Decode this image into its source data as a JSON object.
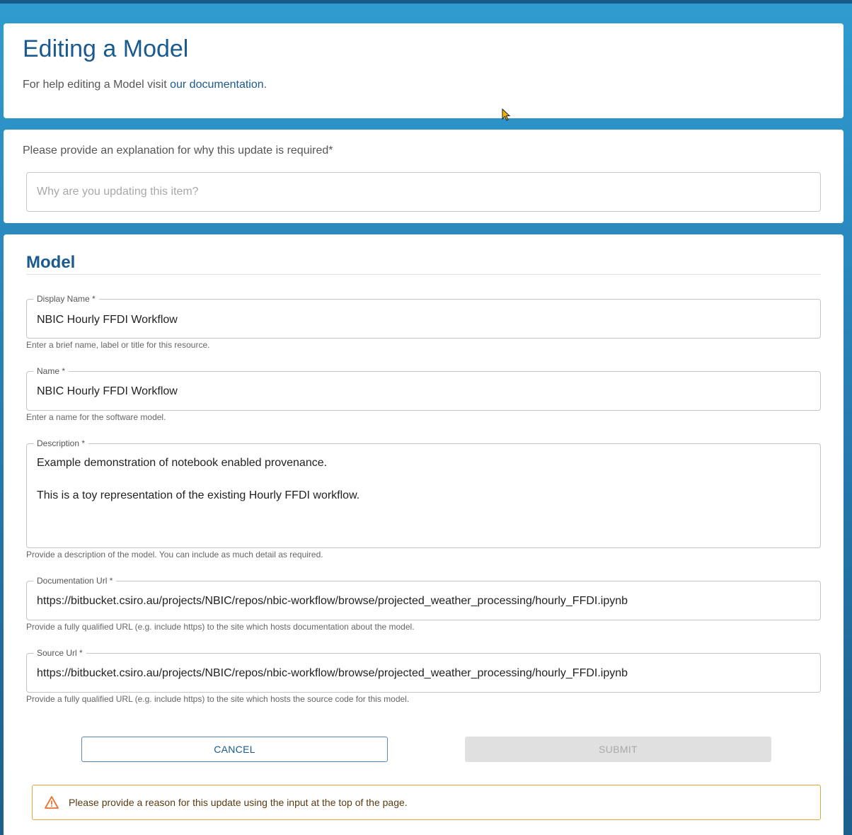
{
  "header": {
    "title": "Editing a Model",
    "help_prefix": "For help editing a Model visit ",
    "help_link": "our documentation",
    "help_suffix": "."
  },
  "reason": {
    "label": "Please provide an explanation for why this update is required*",
    "placeholder": "Why are you updating this item?",
    "value": ""
  },
  "model": {
    "section_title": "Model",
    "fields": [
      {
        "label": "Display Name *",
        "value": "NBIC Hourly FFDI Workflow",
        "helper": "Enter a brief name, label or title for this resource."
      },
      {
        "label": "Name *",
        "value": "NBIC Hourly FFDI Workflow",
        "helper": "Enter a name for the software model."
      },
      {
        "label": "Description *",
        "value": "Example demonstration of notebook enabled provenance.\n\nThis is a toy representation of the existing Hourly FFDI workflow.",
        "helper": "Provide a description of the model. You can include as much detail as required."
      },
      {
        "label": "Documentation Url *",
        "value": "https://bitbucket.csiro.au/projects/NBIC/repos/nbic-workflow/browse/projected_weather_processing/hourly_FFDI.ipynb",
        "helper": "Provide a fully qualified URL (e.g. include https) to the site which hosts documentation about the model."
      },
      {
        "label": "Source Url *",
        "value": "https://bitbucket.csiro.au/projects/NBIC/repos/nbic-workflow/browse/projected_weather_processing/hourly_FFDI.ipynb",
        "helper": "Provide a fully qualified URL (e.g. include https) to the site which hosts the source code for this model."
      }
    ]
  },
  "actions": {
    "cancel_label": "CANCEL",
    "submit_label": "SUBMIT"
  },
  "alert": {
    "icon": "warning-triangle-icon",
    "text": "Please provide a reason for this update using the input at the top of the page.",
    "border_color": "#e8a33d"
  },
  "colors": {
    "accent": "#1a5a8f",
    "background_top": "#2f9ccf",
    "background_bottom": "#1c5f8d",
    "warning": "#e8732d"
  }
}
